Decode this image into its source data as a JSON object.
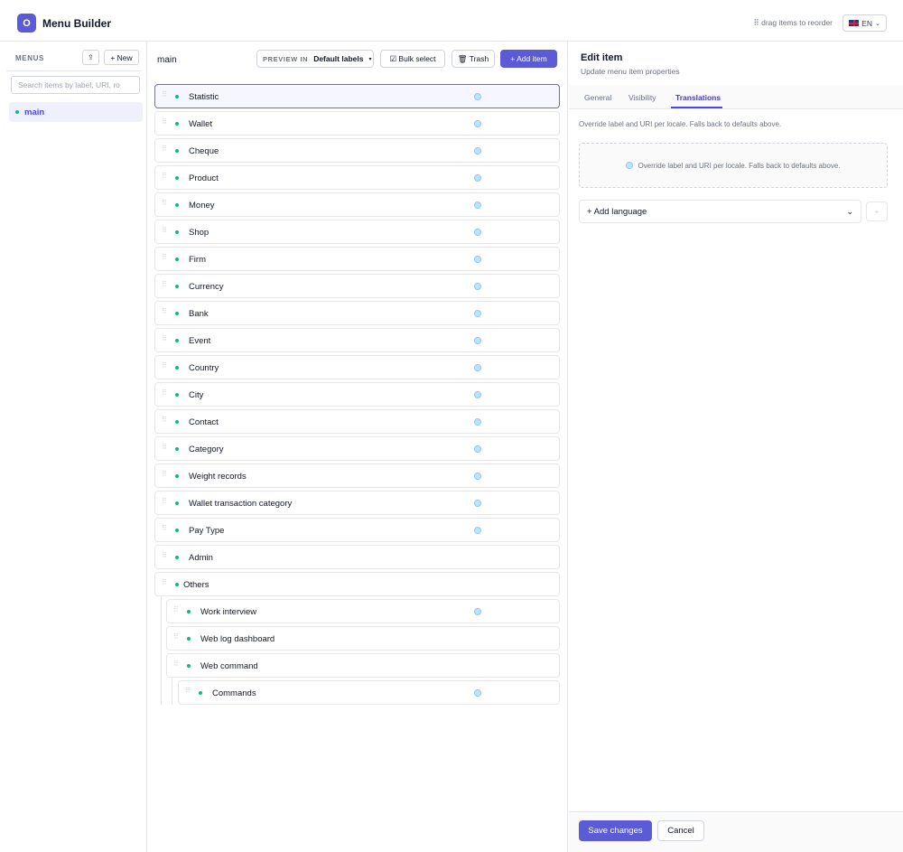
{
  "app": {
    "logo_letter": "O",
    "title": "Menu Builder",
    "drag_hint": "⠿ drag items to reorder",
    "language": "EN"
  },
  "sidebar": {
    "title": "MENUS",
    "up_icon": "⇪",
    "new_label": "+ New",
    "search_placeholder": "Search items by label, URI, ro",
    "menus": [
      {
        "label": "main"
      }
    ]
  },
  "toolbar": {
    "menu_name": "main",
    "preview_label": "PREVIEW IN",
    "preview_value": "Default labels",
    "bulk_select": "☑ Bulk select",
    "trash": "🗑 Trash",
    "add_item": "+ Add item"
  },
  "items": [
    {
      "label": "Statistic",
      "depth": 0,
      "translations": true,
      "selected": true
    },
    {
      "label": "Wallet",
      "depth": 0,
      "translations": true
    },
    {
      "label": "Cheque",
      "depth": 0,
      "translations": true
    },
    {
      "label": "Product",
      "depth": 0,
      "translations": true
    },
    {
      "label": "Money",
      "depth": 0,
      "translations": true
    },
    {
      "label": "Shop",
      "depth": 0,
      "translations": true
    },
    {
      "label": "Firm",
      "depth": 0,
      "translations": true
    },
    {
      "label": "Currency",
      "depth": 0,
      "translations": true
    },
    {
      "label": "Bank",
      "depth": 0,
      "translations": true
    },
    {
      "label": "Event",
      "depth": 0,
      "translations": true
    },
    {
      "label": "Country",
      "depth": 0,
      "translations": true
    },
    {
      "label": "City",
      "depth": 0,
      "translations": true
    },
    {
      "label": "Contact",
      "depth": 0,
      "translations": true
    },
    {
      "label": "Category",
      "depth": 0,
      "translations": true
    },
    {
      "label": "Weight records",
      "depth": 0,
      "translations": true
    },
    {
      "label": "Wallet transaction category",
      "depth": 0,
      "translations": true
    },
    {
      "label": "Pay Type",
      "depth": 0,
      "translations": true
    },
    {
      "label": "Admin",
      "depth": 0,
      "translations": false
    },
    {
      "label": "Others",
      "depth": 0,
      "translations": false
    },
    {
      "label": "Work interview",
      "depth": 1,
      "translations": true
    },
    {
      "label": "Web log dashboard",
      "depth": 1,
      "translations": false
    },
    {
      "label": "Web command",
      "depth": 1,
      "translations": false
    },
    {
      "label": "Commands",
      "depth": 2,
      "translations": true
    }
  ],
  "edit_panel": {
    "title": "Edit item",
    "subtitle": "Update menu item properties",
    "tabs": [
      "General",
      "Visibility",
      "Translations"
    ],
    "active_tab": "Translations",
    "description": "Override label and URI per locale. Falls back to defaults above.",
    "empty_state": "Override label and URI per locale. Falls back to defaults above.",
    "add_language": "+ Add language",
    "add_language_plus": "+",
    "save": "Save changes",
    "cancel": "Cancel"
  },
  "colors": {
    "accent": "#5b5bd6",
    "status_dot": "#10b981",
    "translation_icon": "#bae6fd"
  }
}
